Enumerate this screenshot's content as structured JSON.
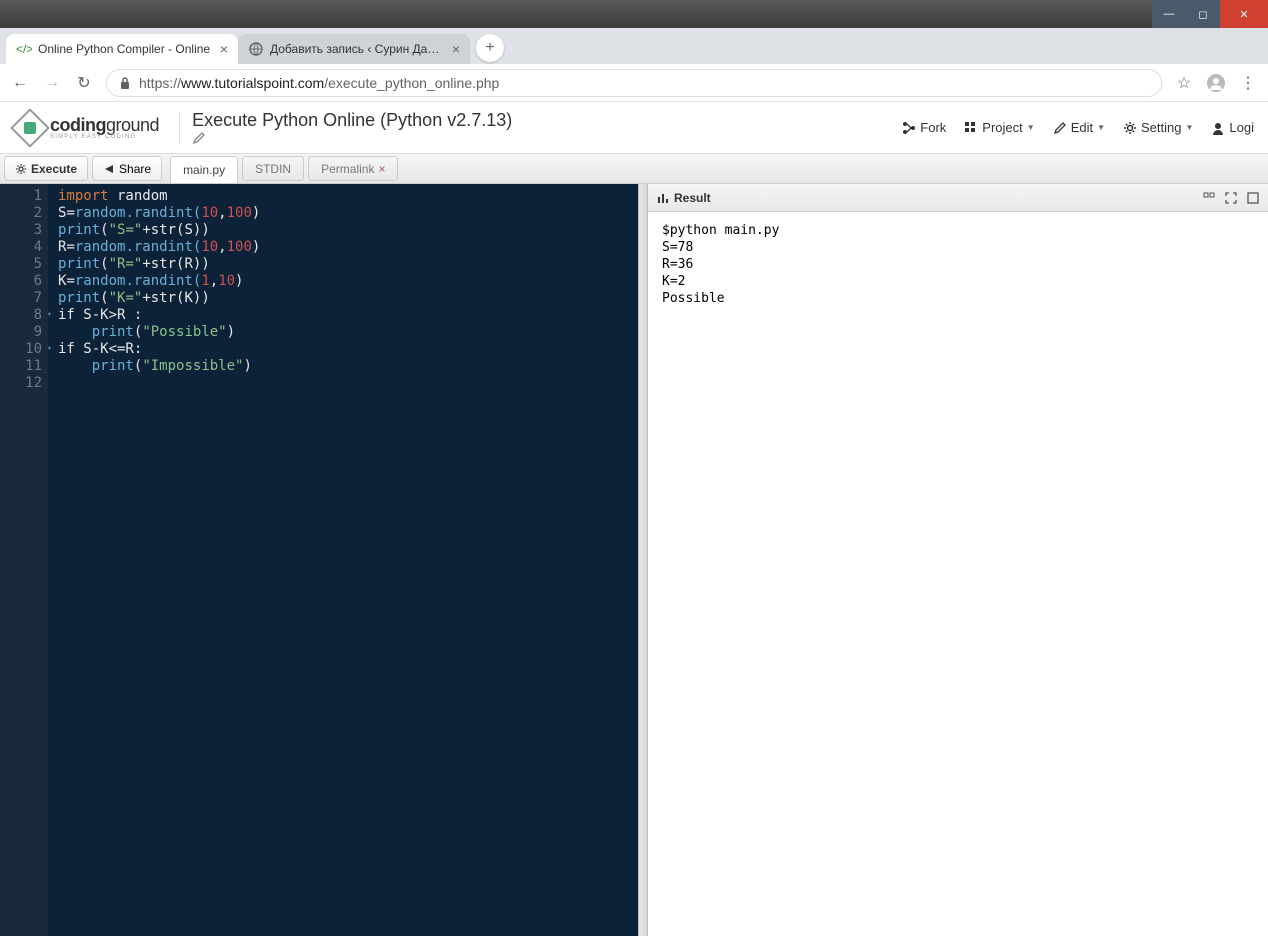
{
  "window": {
    "min": "—",
    "max": "◻",
    "close": "✕"
  },
  "tabs": {
    "active": "Online Python Compiler - Online",
    "inactive": "Добавить запись ‹ Сурин Данил",
    "newtab": "+"
  },
  "addr": {
    "back": "←",
    "fwd": "→",
    "reload": "↻",
    "url_prefix": "https://",
    "url_domain": "www.tutorialspoint.com",
    "url_path": "/execute_python_online.php",
    "star": "☆",
    "user": "◯",
    "menu": "⋮"
  },
  "site": {
    "logo_top": "codingground",
    "logo_bold": "coding",
    "logo_sub": "SIMPLY EASY CODING",
    "title": "Execute Python Online (Python v2.7.13)",
    "right": {
      "fork": "Fork",
      "project": "Project",
      "edit": "Edit",
      "setting": "Setting",
      "login": "Logi"
    }
  },
  "toolbar": {
    "execute": "Execute",
    "share": "Share",
    "file_tab": "main.py",
    "stdin": "STDIN",
    "permalink": "Permalink"
  },
  "code": {
    "lines": [
      "1",
      "2",
      "3",
      "4",
      "5",
      "6",
      "7",
      "8",
      "9",
      "10",
      "11",
      "12"
    ],
    "fold_lines": [
      8,
      10
    ],
    "l1_import": "import",
    "l1_random": " random",
    "l2_s": "S",
    "l2_eq": "=",
    "l2_rand": "random.randint(",
    "l2_a": "10",
    "l2_c": ",",
    "l2_b": "100",
    "l2_rp": ")",
    "l3_print": "print",
    "l3_p": "(",
    "l3_str": "\"S=\"",
    "l3_plus": "+str(S))",
    "l4_r": "R",
    "l4_rand": "random.randint(",
    "l4_a": "10",
    "l4_c": ",",
    "l4_b": "100",
    "l4_rp": ")",
    "l5_print": "print",
    "l5_p": "(",
    "l5_str": "\"R=\"",
    "l5_plus": "+str(R))",
    "l6_k": "K",
    "l6_rand": "random.randint(",
    "l6_a": "1",
    "l6_c": ",",
    "l6_b": "10",
    "l6_rp": ")",
    "l7_print": "print",
    "l7_p": "(",
    "l7_str": "\"K=\"",
    "l7_plus": "+str(K))",
    "l8": "if S-K>R :",
    "l9_ind": "    ",
    "l9_print": "print",
    "l9_p": "(",
    "l9_str": "\"Possible\"",
    "l9_rp": ")",
    "l10": "if S-K<=R:",
    "l11_ind": "    ",
    "l11_print": "print",
    "l11_p": "(",
    "l11_str": "\"Impossible\"",
    "l11_rp": ")"
  },
  "result": {
    "label": "Result",
    "output": "$python main.py\nS=78\nR=36\nK=2\nPossible"
  }
}
